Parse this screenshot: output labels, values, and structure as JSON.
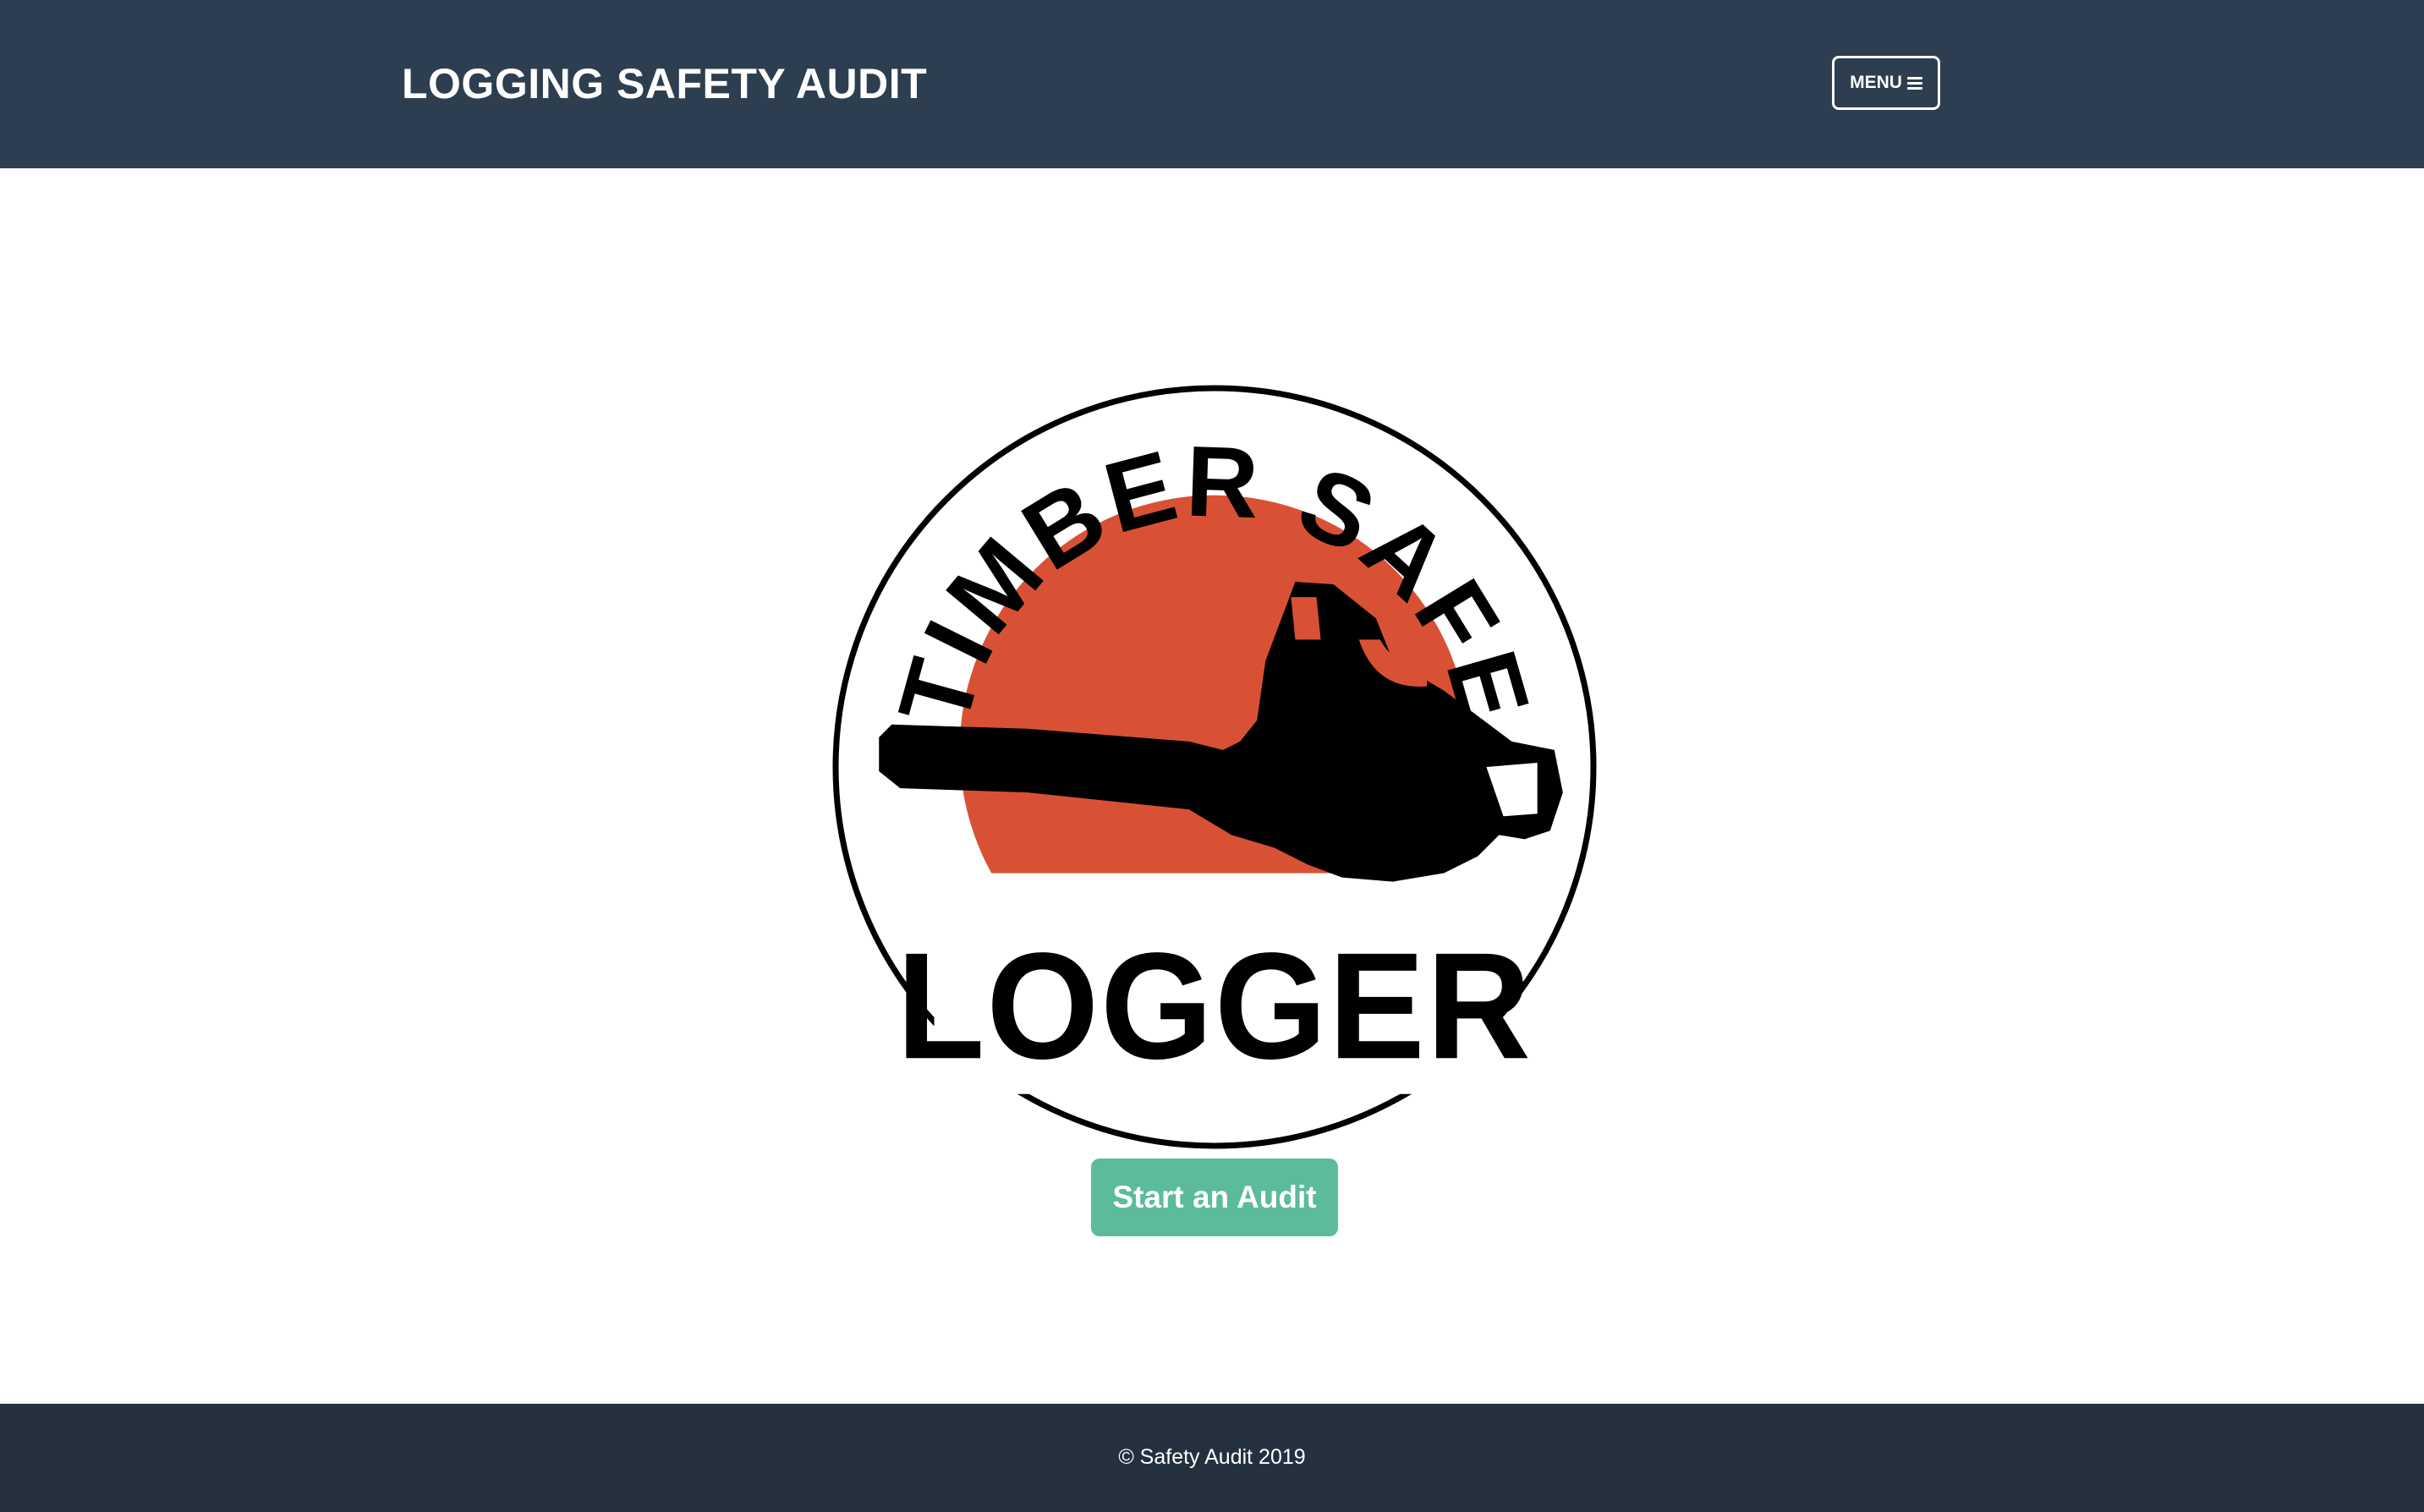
{
  "header": {
    "title": "LOGGING SAFETY AUDIT",
    "menu_label": "MENU",
    "menu_icon": "bars-icon",
    "background_color": "#2d3e50"
  },
  "logo": {
    "top_text": "TIMBER SAFE",
    "bottom_text": "LOGGER",
    "icon": "chainsaw-icon",
    "accent_color": "#d95135"
  },
  "main": {
    "start_button_label": "Start an Audit",
    "button_color": "#5cbb9b"
  },
  "footer": {
    "copyright": "© Safety Audit 2019",
    "background_color": "#25303f"
  }
}
